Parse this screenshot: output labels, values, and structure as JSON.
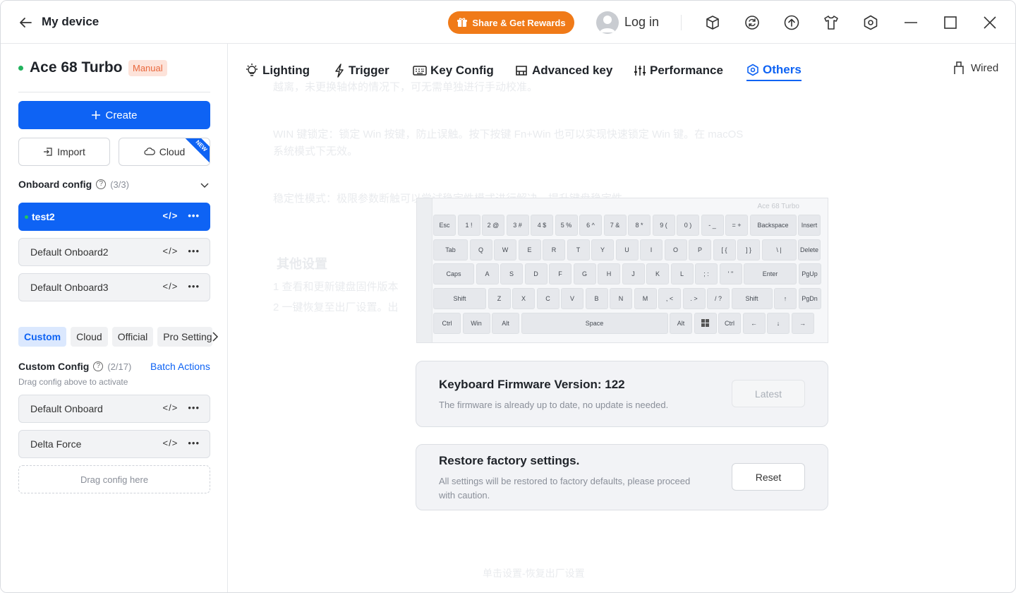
{
  "titlebar": {
    "title": "My device",
    "share_label": "Share & Get Rewards",
    "login_label": "Log in",
    "icons": [
      "cube-icon",
      "sync-icon",
      "upload-icon",
      "tshirt-icon",
      "settings-icon",
      "minimize-icon",
      "maximize-icon",
      "close-icon"
    ]
  },
  "sidebar": {
    "device_name": "Ace 68 Turbo",
    "mode_badge": "Manual",
    "create_label": "Create",
    "import_label": "Import",
    "cloud_label": "Cloud",
    "new_badge": "NEW",
    "onboard": {
      "title": "Onboard config",
      "count": "(3/3)",
      "items": [
        {
          "label": "test2",
          "active": true
        },
        {
          "label": "Default Onboard2",
          "active": false
        },
        {
          "label": "Default Onboard3",
          "active": false
        }
      ]
    },
    "tabs": [
      "Custom",
      "Cloud",
      "Official",
      "Pro Settings"
    ],
    "custom": {
      "title": "Custom Config",
      "count": "(2/17)",
      "batch_label": "Batch Actions",
      "hint": "Drag config above to activate",
      "items": [
        "Default Onboard",
        "Delta Force"
      ],
      "drop_label": "Drag config here"
    }
  },
  "nav": {
    "items": [
      "Lighting",
      "Trigger",
      "Key Config",
      "Advanced key",
      "Performance",
      "Others"
    ],
    "active": "Others",
    "connection": "Wired"
  },
  "background_text": {
    "line1": "越离，未更换轴体的情况下，可无需单独进行手动校准。",
    "line2": "WIN 键锁定：锁定 Win 按键，防止误触。按下按键 Fn+Win 也可以实现快速锁定 Win 键。在 macOS",
    "line3": "系统模式下无效。",
    "line4": "稳定性模式：极限参数断触可以尝试稳定性模式进行解决，提升键盘稳定性。",
    "heading": "其他设置",
    "item1": "1   查看和更新键盘固件版本",
    "item2": "2   一键恢复至出厂设置。出",
    "footer": "单击设置-恢复出厂设置"
  },
  "keyboard": {
    "name": "Ace 68 Turbo",
    "rows": [
      [
        "Esc",
        "1 !",
        "2 @",
        "3 #",
        "4 $",
        "5 %",
        "6 ^",
        "7 &",
        "8 *",
        "9 (",
        "0 )",
        "- _",
        "= +",
        "Backspace",
        "Insert"
      ],
      [
        "Tab",
        "Q",
        "W",
        "E",
        "R",
        "T",
        "Y",
        "U",
        "I",
        "O",
        "P",
        "[ {",
        "] }",
        "\\ |",
        "Delete"
      ],
      [
        "Caps",
        "A",
        "S",
        "D",
        "F",
        "G",
        "H",
        "J",
        "K",
        "L",
        "; :",
        "' \"",
        "Enter",
        "PgUp"
      ],
      [
        "Shift",
        "Z",
        "X",
        "C",
        "V",
        "B",
        "N",
        "M",
        ", <",
        ". >",
        "/ ?",
        "Shift",
        "↑",
        "PgDn"
      ],
      [
        "Ctrl",
        "Win",
        "Alt",
        "Space",
        "Alt",
        "",
        "Ctrl",
        "←",
        "↓",
        "→"
      ]
    ]
  },
  "firmware": {
    "title": "Keyboard Firmware Version:  122",
    "desc": "The firmware is already up to date, no update is needed.",
    "button": "Latest"
  },
  "restore": {
    "title": "Restore factory settings.",
    "desc": "All settings will be restored to factory defaults, please proceed with caution.",
    "button": "Reset"
  },
  "colors": {
    "accent": "#0e63f4",
    "share": "#f07a18",
    "online": "#22b35e",
    "manual_badge": "#e9683d"
  }
}
